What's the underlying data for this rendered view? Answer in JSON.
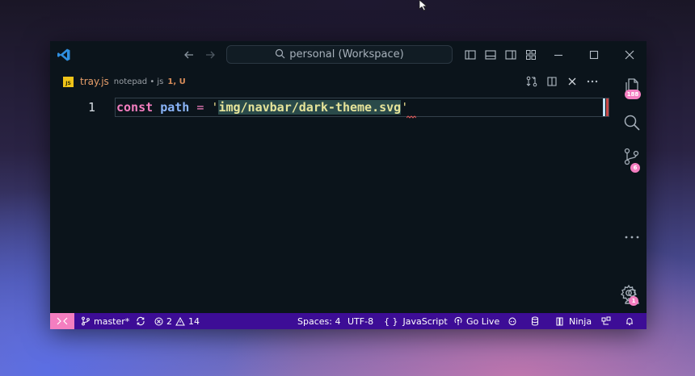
{
  "window": {
    "command_center": "personal (Workspace)",
    "icons": {
      "logo": "vscode-logo",
      "back": "arrow-left-icon",
      "forward": "arrow-right-icon",
      "layout": [
        "toggle-primary-sidebar-icon",
        "toggle-panel-icon",
        "toggle-secondary-sidebar-icon",
        "customize-layout-icon"
      ],
      "window_controls": [
        "minimize-icon",
        "maximize-icon",
        "close-icon"
      ]
    }
  },
  "tab": {
    "icon_label": "JS",
    "filename": "tray.js",
    "description": "notepad • js",
    "status": "1, U",
    "actions": [
      "open-changes-icon",
      "split-editor-icon",
      "close-icon",
      "more-actions-icon"
    ]
  },
  "editor": {
    "line_number": "1",
    "code": {
      "keyword": "const",
      "variable": "path",
      "operator": "=",
      "quote_open": "'",
      "string": "img/navbar/dark-theme.svg",
      "quote_close": "'"
    }
  },
  "activity_bar": {
    "explorer_badge": "188",
    "scm_badge": "6",
    "settings_badge": "1"
  },
  "status_bar": {
    "branch": "master*",
    "errors": "2",
    "warnings": "14",
    "spaces": "Spaces: 4",
    "encoding": "UTF-8",
    "language_braces": "{ }",
    "language": "JavaScript",
    "go_live": "Go Live",
    "ninja": "Ninja"
  },
  "colors": {
    "editor_bg": "#0b141b",
    "status_bar_bg": "#3d0d96",
    "accent_pink": "#f47ec0",
    "string_highlight": "#2a4a4a"
  }
}
